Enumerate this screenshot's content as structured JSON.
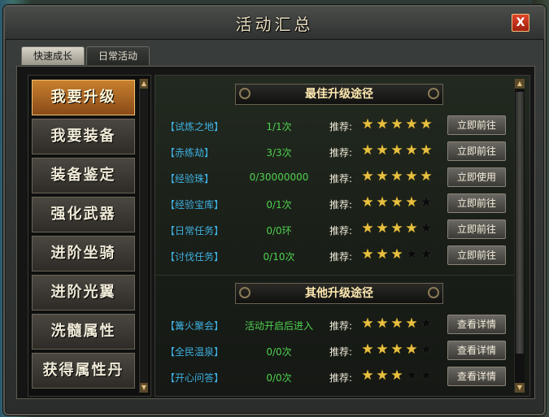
{
  "window": {
    "title": "活动汇总",
    "close_label": "X"
  },
  "tabs": [
    {
      "label": "快速成长",
      "active": true
    },
    {
      "label": "日常活动",
      "active": false
    }
  ],
  "nav": {
    "items": [
      {
        "label": "我要升级",
        "active": true
      },
      {
        "label": "我要装备",
        "active": false
      },
      {
        "label": "装备鉴定",
        "active": false
      },
      {
        "label": "强化武器",
        "active": false
      },
      {
        "label": "进阶坐骑",
        "active": false
      },
      {
        "label": "进阶光翼",
        "active": false
      },
      {
        "label": "洗髓属性",
        "active": false
      },
      {
        "label": "获得属性丹",
        "active": false
      }
    ]
  },
  "sections": [
    {
      "title": "最佳升级途径",
      "rows": [
        {
          "name": "【试炼之地】",
          "progress": "1/1次",
          "rec_label": "推荐:",
          "stars": 5,
          "button": "立即前往"
        },
        {
          "name": "【赤练劫】",
          "progress": "3/3次",
          "rec_label": "推荐:",
          "stars": 5,
          "button": "立即前往"
        },
        {
          "name": "【经验珠】",
          "progress": "0/30000000",
          "rec_label": "推荐:",
          "stars": 5,
          "button": "立即使用"
        },
        {
          "name": "【经验宝库】",
          "progress": "0/1次",
          "rec_label": "推荐:",
          "stars": 4,
          "button": "立即前往"
        },
        {
          "name": "【日常任务】",
          "progress": "0/0环",
          "rec_label": "推荐:",
          "stars": 4,
          "button": "立即前往"
        },
        {
          "name": "【讨伐任务】",
          "progress": "0/10次",
          "rec_label": "推荐:",
          "stars": 3,
          "button": "立即前往"
        }
      ]
    },
    {
      "title": "其他升级途径",
      "rows": [
        {
          "name": "【篝火聚会】",
          "progress": "活动开启后进入",
          "rec_label": "推荐:",
          "stars": 4,
          "button": "查看详情"
        },
        {
          "name": "【全民温泉】",
          "progress": "0/0次",
          "rec_label": "推荐:",
          "stars": 4,
          "button": "查看详情"
        },
        {
          "name": "【开心问答】",
          "progress": "0/0次",
          "rec_label": "推荐:",
          "stars": 3,
          "button": "查看详情"
        }
      ]
    }
  ],
  "max_stars": 5,
  "colors": {
    "activity_name": "#3fb0e0",
    "progress": "#4fd14f",
    "star_on": "#e8c040",
    "star_off": "#0a0a0a",
    "nav_active": "#c8802e"
  },
  "icons": {
    "close": "close-icon",
    "scroll_up": "arrow-up-icon",
    "scroll_down": "arrow-down-icon",
    "star": "star-icon"
  }
}
